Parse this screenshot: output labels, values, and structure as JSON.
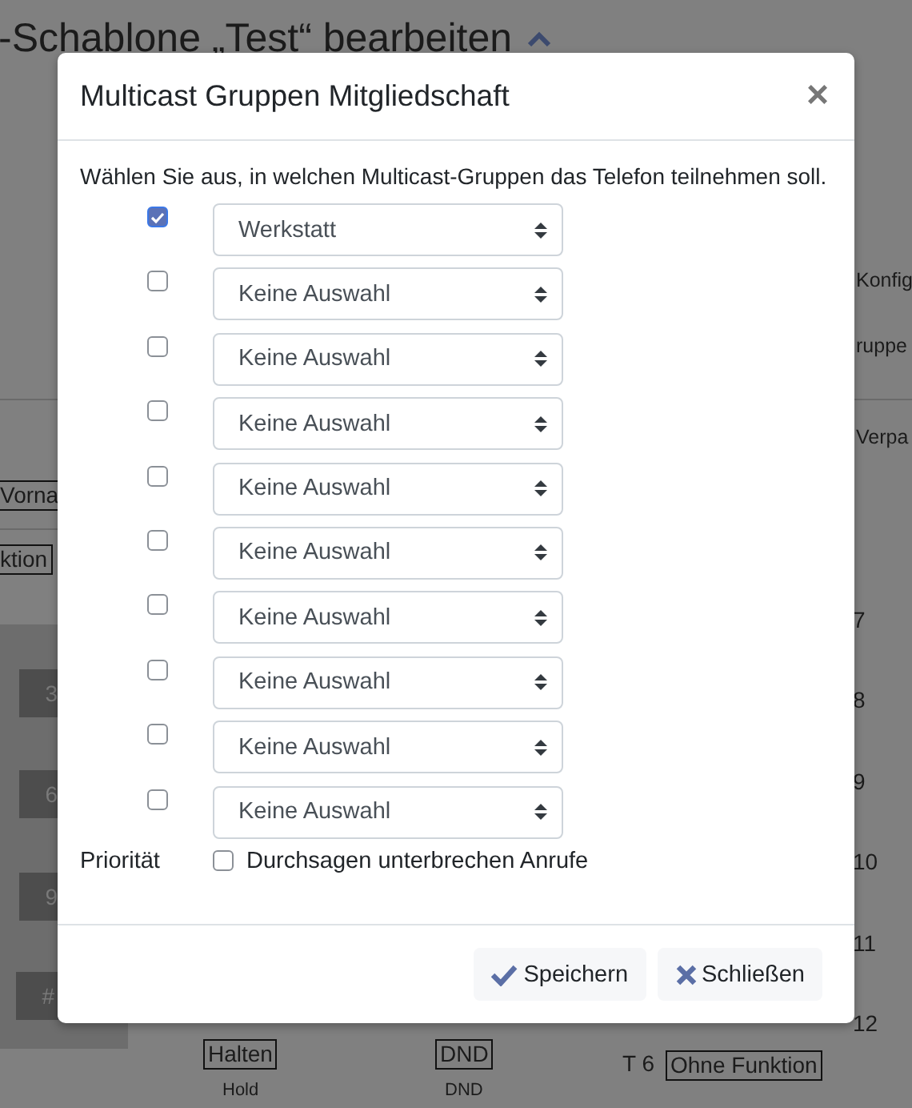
{
  "page": {
    "title": "-Schablone „Test“ bearbeiten",
    "right_labels": [
      "Konfig",
      "ruppe",
      "Verpa"
    ],
    "left_boxes": [
      "Vorna",
      "ktion"
    ],
    "keypad": [
      "3",
      "6",
      "9",
      "#"
    ],
    "key_numbers": [
      "7",
      "8",
      "9",
      "10",
      "11",
      "12"
    ],
    "bottom": [
      {
        "label": "Halten",
        "caption": "Hold"
      },
      {
        "label": "DND",
        "caption": "DND"
      }
    ],
    "key_row": {
      "number": "T 6",
      "function": "Ohne Funktion"
    }
  },
  "dialog": {
    "title": "Multicast Gruppen Mitgliedschaft",
    "close": "×",
    "intro": "Wählen Sie aus, in welchen Multicast-Gruppen das Telefon teilnehmen soll.",
    "groups": [
      {
        "checked": true,
        "value": "Werkstatt"
      },
      {
        "checked": false,
        "value": "Keine Auswahl"
      },
      {
        "checked": false,
        "value": "Keine Auswahl"
      },
      {
        "checked": false,
        "value": "Keine Auswahl"
      },
      {
        "checked": false,
        "value": "Keine Auswahl"
      },
      {
        "checked": false,
        "value": "Keine Auswahl"
      },
      {
        "checked": false,
        "value": "Keine Auswahl"
      },
      {
        "checked": false,
        "value": "Keine Auswahl"
      },
      {
        "checked": false,
        "value": "Keine Auswahl"
      },
      {
        "checked": false,
        "value": "Keine Auswahl"
      }
    ],
    "priority": {
      "label": "Priorität",
      "option": "Durchsagen unterbrechen Anrufe",
      "checked": false
    },
    "buttons": [
      {
        "kind": "save",
        "label": "Speichern"
      },
      {
        "kind": "close",
        "label": "Schließen"
      }
    ]
  }
}
